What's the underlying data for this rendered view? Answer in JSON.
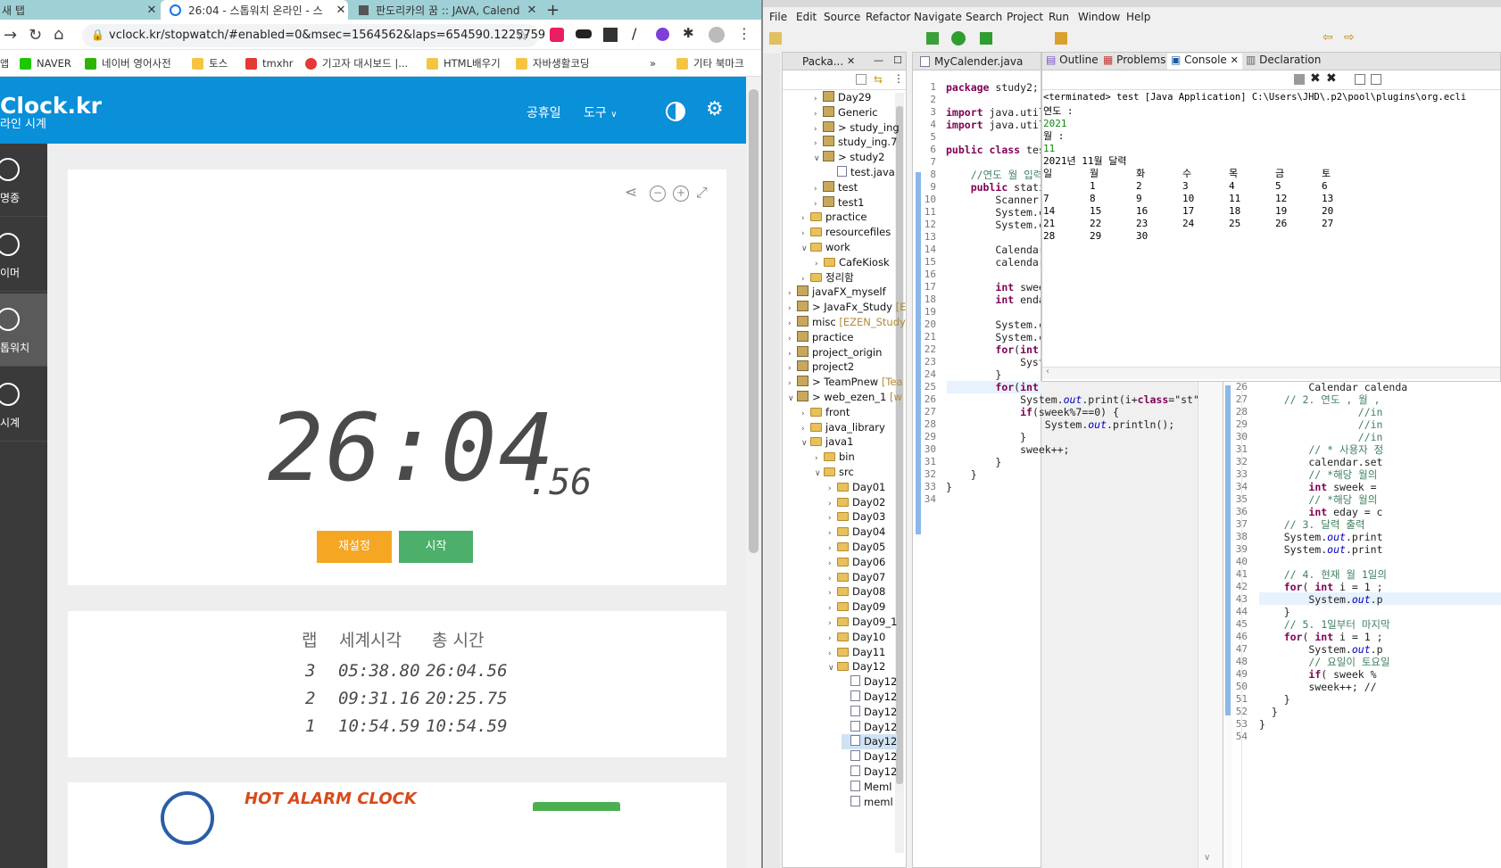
{
  "browser": {
    "tabs": [
      {
        "label": "새 탭"
      },
      {
        "label": "26:04 - 스톱워치 온라인 - 스"
      },
      {
        "label": "판도리카의 꿈 :: JAVA, Calend"
      }
    ],
    "new_tab": "+",
    "url": "vclock.kr/stopwatch/#enabled=0&msec=1564562&laps=654590.1225759",
    "bookmarks": [
      "NAVER",
      "네이버 영어사전",
      "토스",
      "tmxhr",
      "기고자 대시보드 |...",
      "HTML배우기",
      "자바생활코딩"
    ],
    "bookmarks_overflow": "»",
    "other_bookmarks": "기타 북마크",
    "colors": {
      "site_blue": "#0a8fd9",
      "reset_btn": "#f5a623",
      "start_btn": "#4caf6a"
    }
  },
  "site": {
    "logo_main": "Clock.kr",
    "logo_sub": "라인 시계",
    "nav": [
      "공휴일",
      "도구"
    ],
    "sidebar": [
      "명종",
      "이머",
      "톱워치",
      "시계"
    ],
    "display_main": "26:04",
    "display_ms": ".56",
    "reset_label": "재설정",
    "start_label": "시작",
    "lap_headers": [
      "랩",
      "세계시각",
      "총 시간"
    ],
    "laps": [
      {
        "n": "3",
        "world": "05:38.80",
        "total": "26:04.56"
      },
      {
        "n": "2",
        "world": "09:31.16",
        "total": "20:25.75"
      },
      {
        "n": "1",
        "world": "10:54.59",
        "total": "10:54.59"
      }
    ],
    "ad_title": "HOT ALARM CLOCK"
  },
  "eclipse": {
    "menu": [
      "File",
      "Edit",
      "Source",
      "Refactor",
      "Navigate",
      "Search",
      "Project",
      "Run",
      "Window",
      "Help"
    ],
    "pkg_tab": "Packa...",
    "editor_tab": "MyCalender.java",
    "console_tabs": [
      "Outline",
      "Problems",
      "Console",
      "Declaration"
    ],
    "terminated": "<terminated> test [Java Application] C:\\Users\\JHD\\.p2\\pool\\plugins\\org.ecli",
    "tree": [
      "Day29",
      "Generic",
      "> study_ing",
      "study_ing.7",
      "> study2",
      "test.java",
      "test",
      "test1",
      "practice",
      "resourcefiles",
      "work",
      "CafeKiosk",
      "정리함",
      "javaFX_myself",
      "> JavaFx_Study [E",
      "misc [EZEN_Study",
      "practice",
      "project_origin",
      "project2",
      "> TeamPnew [Tea",
      "> web_ezen_1 [w",
      "front",
      "java_library",
      "java1",
      "bin",
      "src",
      "Day01",
      "Day02",
      "Day03",
      "Day04",
      "Day05",
      "Day06",
      "Day07",
      "Day08",
      "Day09",
      "Day09_1",
      "Day10",
      "Day11",
      "Day12",
      "Day12",
      "Day12",
      "Day12",
      "Day12",
      "Day12",
      "Day12",
      "Day12",
      "Meml",
      "meml"
    ],
    "console_out": {
      "year_prompt": "연도 :",
      "year_val": "2021",
      "month_prompt": "월 :",
      "month_val": "11",
      "cal_title": "2021년 11월 달력",
      "weekdays": [
        "일",
        "월",
        "화",
        "수",
        "목",
        "금",
        "토"
      ],
      "rows": [
        [
          "",
          "1",
          "2",
          "3",
          "4",
          "5",
          "6"
        ],
        [
          "7",
          "8",
          "9",
          "10",
          "11",
          "12",
          "13"
        ],
        [
          "14",
          "15",
          "16",
          "17",
          "18",
          "19",
          "20"
        ],
        [
          "21",
          "22",
          "23",
          "24",
          "25",
          "26",
          "27"
        ],
        [
          "28",
          "29",
          "30",
          "",
          "",
          "",
          ""
        ]
      ]
    },
    "code_lines": [
      "package study2;",
      "",
      "import java.util",
      "import java.util",
      "",
      "public class tes",
      "",
      "    //연도 월 입력",
      "    public stati",
      "        Scanner ",
      "        System.c",
      "        System.c",
      "",
      "        Calendar",
      "        calendar",
      "",
      "        int swee",
      "        int enda",
      "",
      "        System.c",
      "        System.c",
      "        for(int ",
      "            Syst",
      "        }",
      "        for(int i= 1; i<=enday; i++) {",
      "            System.out.print(i+\"\\t\");",
      "            if(sweek%7==0) {",
      "                System.out.println();",
      "            }",
      "            sweek++;",
      "        }",
      "    }",
      "}",
      ""
    ],
    "code2_start": 26,
    "code2_lines": [
      "        Calendar calenda",
      "    // 2. 연도 , 월 ,",
      "                //in",
      "                //in",
      "                //in",
      "        // * 사용자 정",
      "        calendar.set",
      "        // *해당 월의",
      "        int sweek =",
      "        // *해당 월의",
      "        int eday = c",
      "    // 3. 달력 출력",
      "    System.out.print",
      "    System.out.print",
      "",
      "    // 4. 현재 월 1일의",
      "    for( int i = 1 ;",
      "        System.out.p",
      "    }",
      "    // 5. 1일부터 마지막",
      "    for( int i = 1 ;",
      "        System.out.p",
      "        // 요일이 토요일",
      "        if( sweek %",
      "        sweek++; //",
      "    }",
      "  }",
      "}",
      ""
    ]
  }
}
